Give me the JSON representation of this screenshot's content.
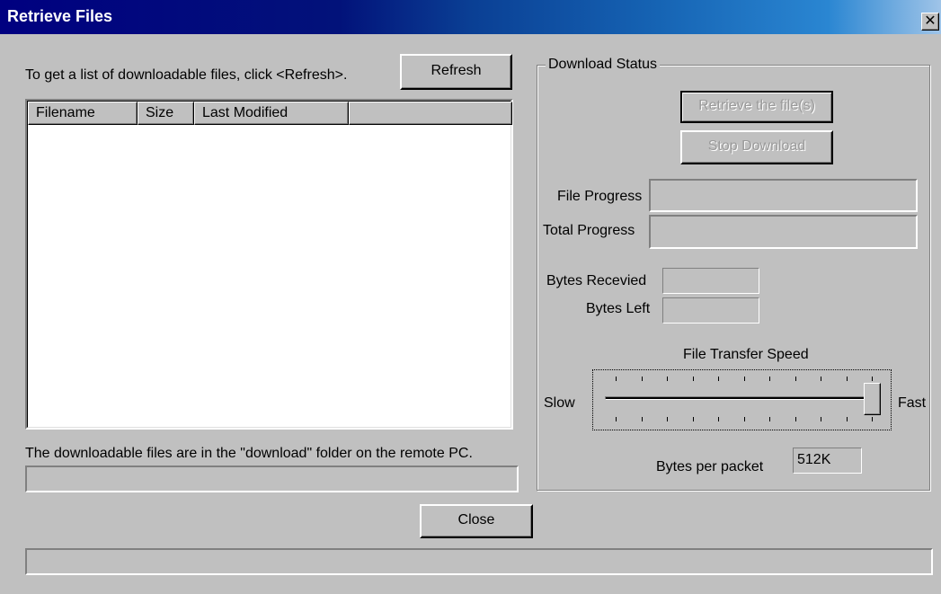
{
  "window": {
    "title": "Retrieve Files",
    "close_glyph": "✕"
  },
  "instructions": "To get a list of downloadable files, click <Refresh>.",
  "refresh_button": "Refresh",
  "file_list": {
    "columns": [
      "Filename",
      "Size",
      "Last Modified",
      ""
    ],
    "rows": []
  },
  "folder_note": "The downloadable files are in the \"download\" folder on the remote PC.",
  "download_status": {
    "group_label": "Download Status",
    "retrieve_button": "Retrieve the file(s)",
    "stop_button": "Stop Download",
    "file_progress_label": "File Progress",
    "file_progress_value": 0,
    "total_progress_label": "Total Progress",
    "total_progress_value": 0,
    "bytes_received_label": "Bytes Recevied",
    "bytes_received_value": "",
    "bytes_left_label": "Bytes Left",
    "bytes_left_value": "",
    "speed_label": "File Transfer Speed",
    "slow_label": "Slow",
    "fast_label": "Fast",
    "slider_level": 1.0,
    "bytes_per_packet_label": "Bytes per packet",
    "bytes_per_packet_value": "512K"
  },
  "close_button": "Close",
  "colors": {
    "face": "#c0c0c0",
    "titlebar_start": "#000080",
    "titlebar_end": "#9fc4e8",
    "disabled_text": "#9a9a9a"
  }
}
